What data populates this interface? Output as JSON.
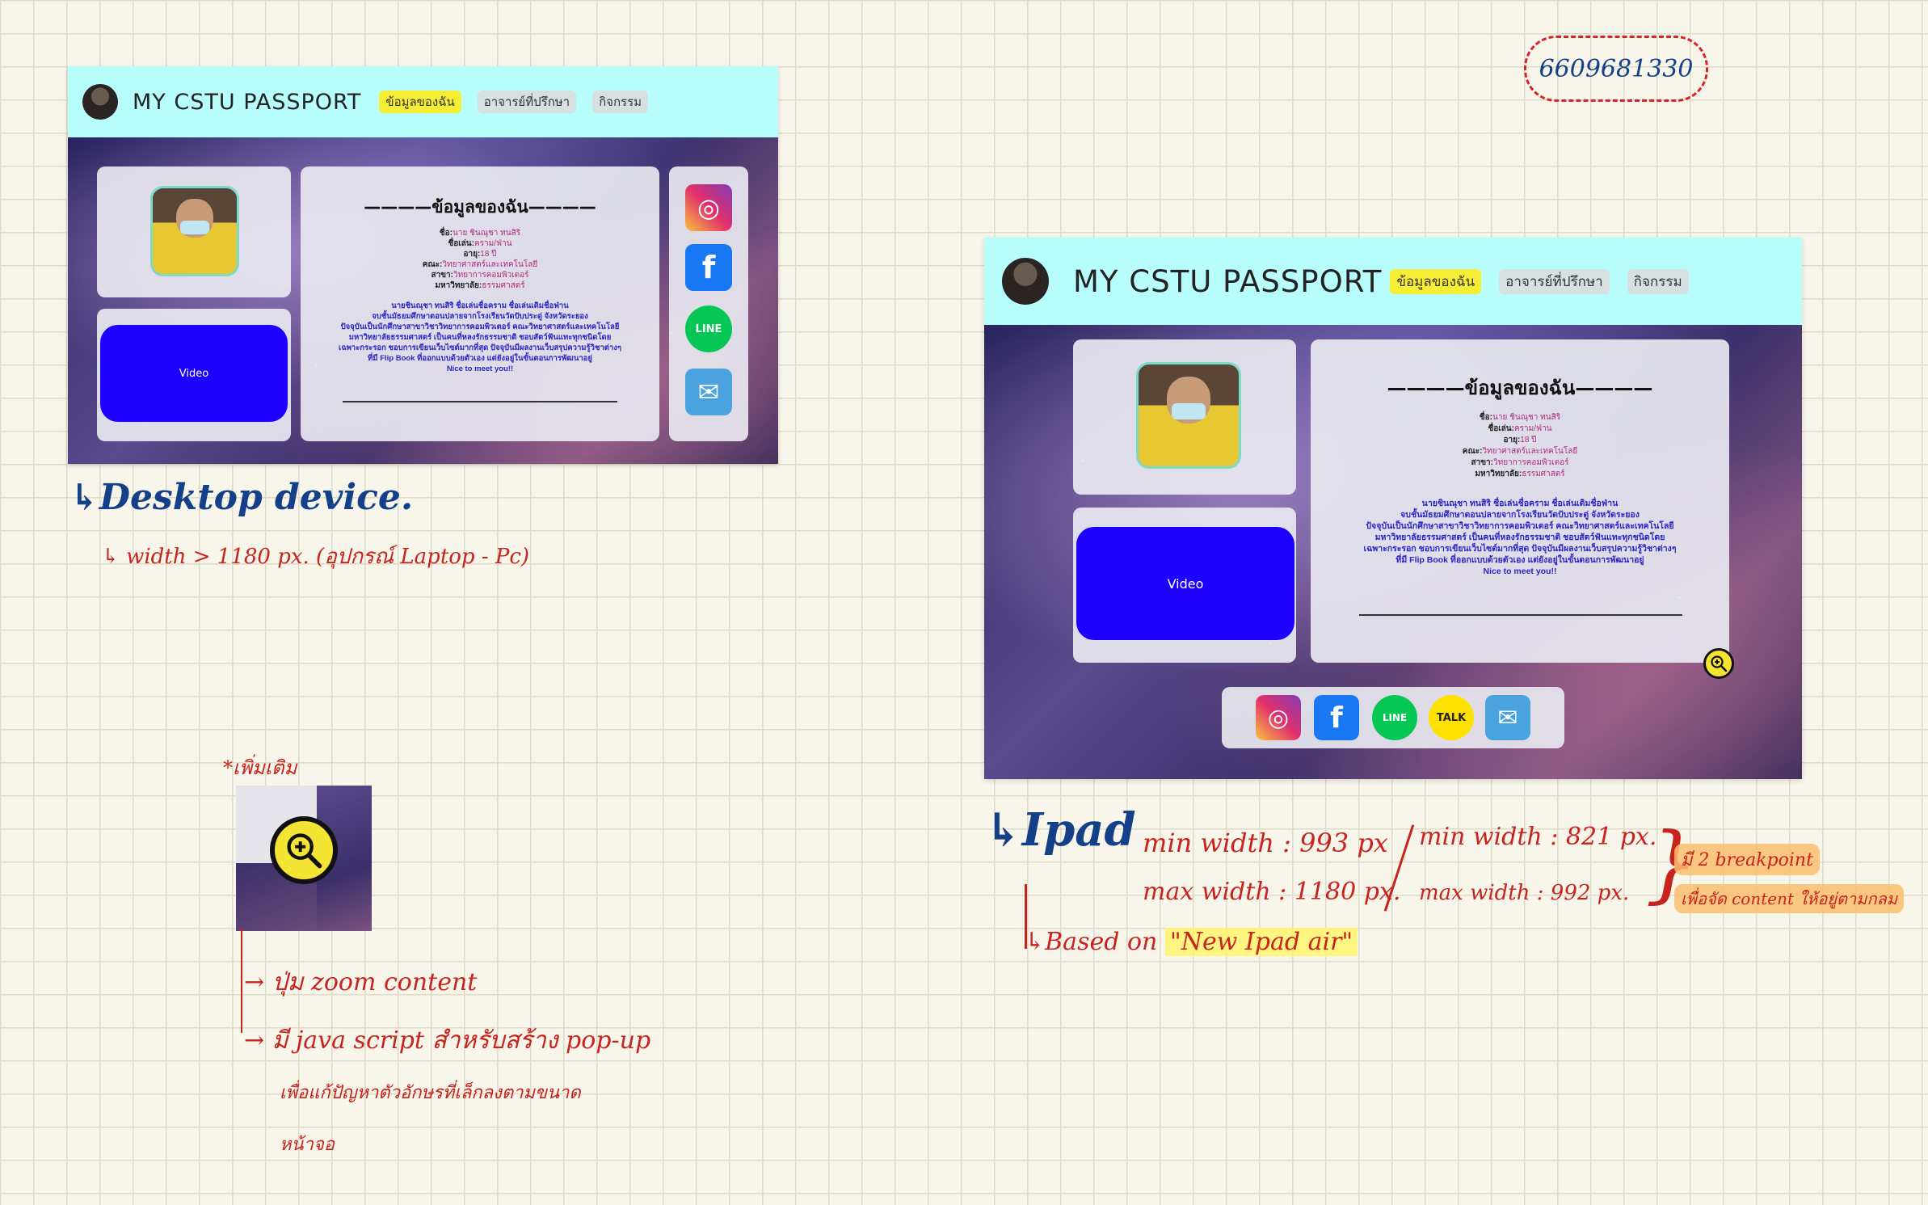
{
  "app": {
    "brand": "MY CSTU PASSPORT",
    "nav": [
      "ข้อมูลของฉัน",
      "อาจารย์ที่ปรึกษา",
      "กิจกรรม"
    ]
  },
  "profile": {
    "title": "————ข้อมูลของฉัน————",
    "fields": [
      {
        "k": "ชื่อ:",
        "v": "นาย ชินณุชา ทนสิริ"
      },
      {
        "k": "ชื่อเล่น:",
        "v": "คราม/ฟ่าน"
      },
      {
        "k": "อายุ:",
        "v": "18 ปี"
      },
      {
        "k": "คณะ:",
        "v": "วิทยาศาสตร์และเทคโนโลยี"
      },
      {
        "k": "สาขา:",
        "v": "วิทยาการคอมพิวเตอร์"
      },
      {
        "k": "มหาวิทยาลัย:",
        "v": "ธรรมศาสตร์"
      }
    ],
    "bio": [
      "นายชินณุชา ทนสิริ ชื่อเล่นชื่อคราม ชื่อเล่นเดิมชื่อฟ่าน",
      "จบชั้นมัธยมศึกษาตอนปลายจากโรงเรียนวัดปับประดู่ จังหวัดระยอง",
      "ปัจจุบันเป็นนักศึกษาสาขาวิชาวิทยาการคอมพิวเตอร์ คณะวิทยาศาสตร์และเทคโนโลยี",
      "มหาวิทยาลัยธรรมศาสตร์ เป็นคนที่หลงรักธรรมชาติ ชอบสัตว์ฟันแทะทุกชนิดโดย",
      "เฉพาะกระรอก ชอบการเขียนเว็บไซต์มากที่สุด ปัจจุบันมีผลงานเว็บสรุปความรู้วิชาต่างๆ",
      "ที่มี Flip Book ที่ออกแบบด้วยตัวเอง แต่ยังอยู่ในขั้นตอนการพัฒนาอยู่",
      "Nice to meet you!!"
    ],
    "bottom_rule": "—————————————————",
    "video_label": "Video"
  },
  "social": {
    "instagram": "◎",
    "facebook": "f",
    "line": "LINE",
    "talk": "TALK",
    "mail": "✉"
  },
  "notes": {
    "student_id": "6609681330",
    "desktop_title": "Desktop device.",
    "desktop_sub": "width > 1180 px. (อุปกรณ์ Laptop - Pc)",
    "extra_title": "*เพิ่มเติม",
    "zoom_note": "ปุ่ม zoom content",
    "js_note": "มี java script สำหรับสร้าง pop-up",
    "js_note2": "เพื่อแก้ปัญหาตัวอักษรที่เล็กลงตามขนาด",
    "js_note3": "หน้าจอ",
    "ipad_title": "Ipad",
    "ipad_min1": "min width : 993 px",
    "ipad_max1": "max width : 1180 px.",
    "ipad_min2": "min width : 821 px.",
    "ipad_max2": "max width : 992 px.",
    "breakpoint_note": "มี 2 breakpoint",
    "breakpoint_note2": "เพื่อจัด content ให้อยู่ตามกลม",
    "based_on": "Based on",
    "based_device": "\"New Ipad air\""
  },
  "colors": {
    "navbar": "#b6fdfb",
    "active_nav": "#f6ee34",
    "video": "#1d00ff",
    "annot_red": "#c8231e",
    "annot_blue": "#14408a"
  }
}
